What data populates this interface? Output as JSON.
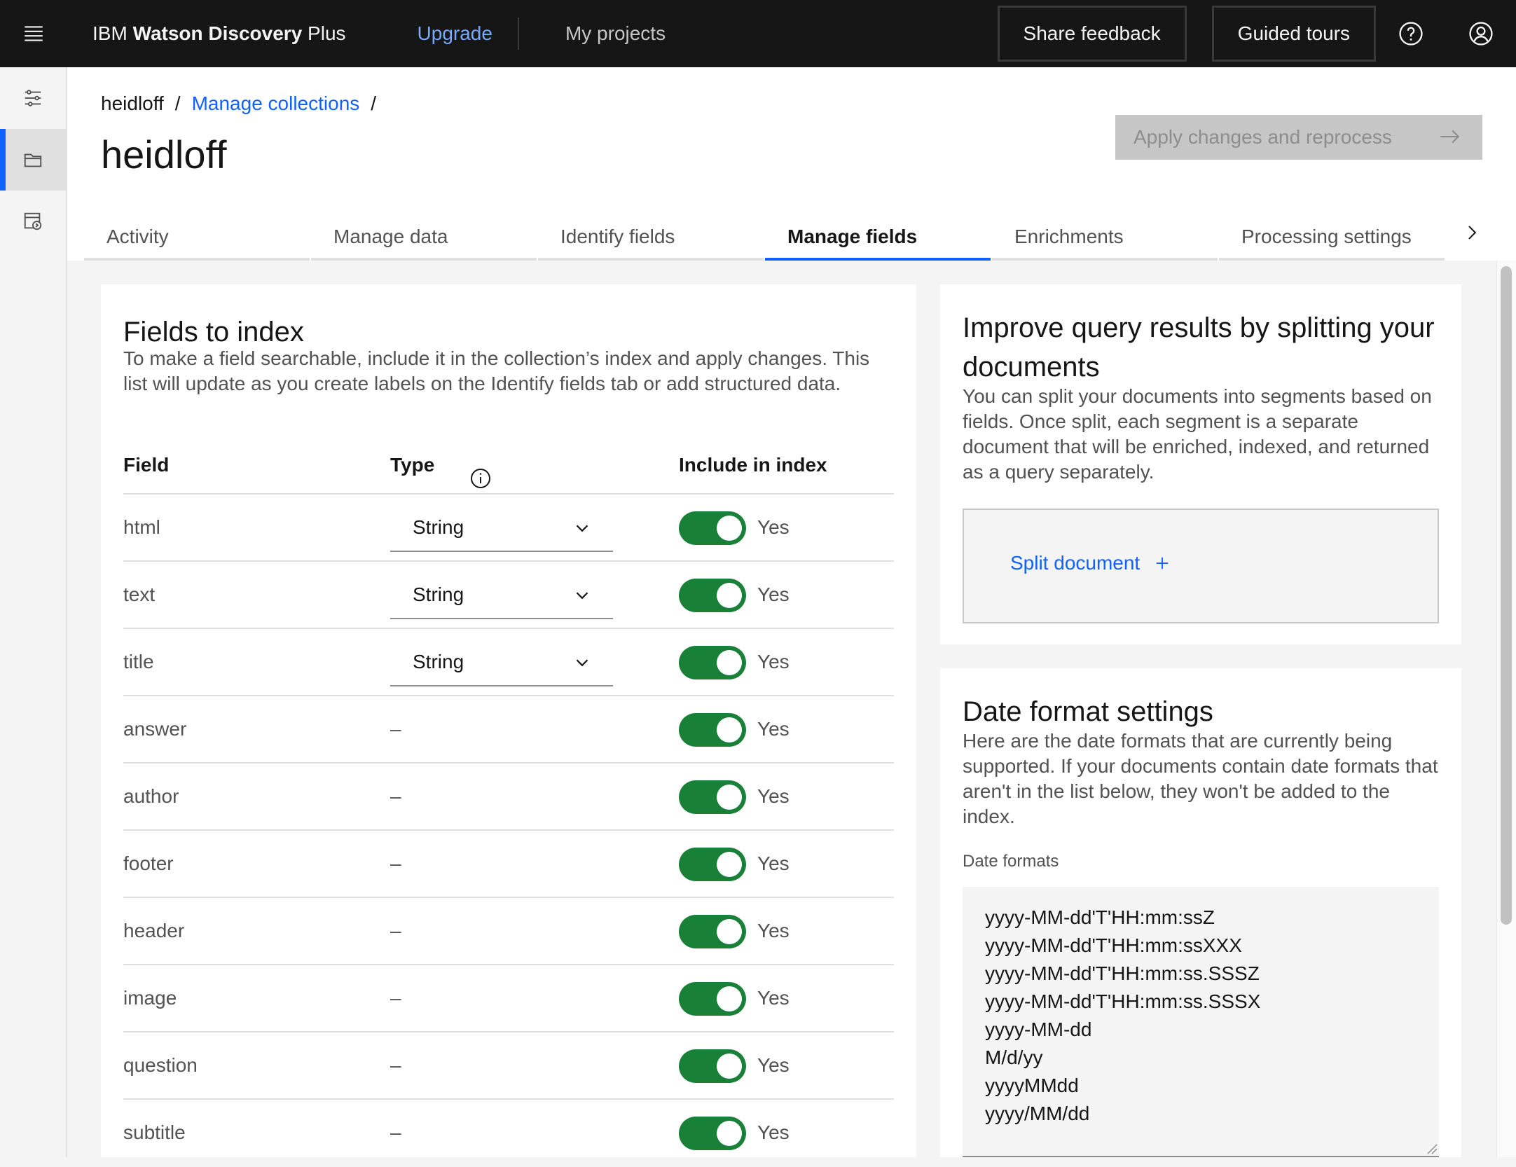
{
  "header": {
    "brand_prefix": "IBM ",
    "brand_bold": "Watson Discovery",
    "brand_suffix": " Plus",
    "upgrade": "Upgrade",
    "my_projects": "My projects",
    "share_feedback": "Share feedback",
    "guided_tours": "Guided tours"
  },
  "breadcrumb": {
    "root": "heidloff",
    "sep": "/",
    "manage_collections": "Manage collections"
  },
  "page_title": "heidloff",
  "apply_button": "Apply changes and reprocess",
  "tabs": [
    "Activity",
    "Manage data",
    "Identify fields",
    "Manage fields",
    "Enrichments",
    "Processing settings"
  ],
  "active_tab": "Manage fields",
  "fields_panel": {
    "title": "Fields to index",
    "description": "To make a field searchable, include it in the collection’s index and apply changes. This list will update as you create labels on the Identify fields tab or add structured data.",
    "col_field": "Field",
    "col_type": "Type",
    "col_include": "Include in index",
    "rows": [
      {
        "field": "html",
        "type": "String",
        "include": "Yes",
        "enabled": true
      },
      {
        "field": "text",
        "type": "String",
        "include": "Yes",
        "enabled": true
      },
      {
        "field": "title",
        "type": "String",
        "include": "Yes",
        "enabled": true
      },
      {
        "field": "answer",
        "type": "–",
        "include": "Yes",
        "enabled": true
      },
      {
        "field": "author",
        "type": "–",
        "include": "Yes",
        "enabled": true
      },
      {
        "field": "footer",
        "type": "–",
        "include": "Yes",
        "enabled": true
      },
      {
        "field": "header",
        "type": "–",
        "include": "Yes",
        "enabled": true
      },
      {
        "field": "image",
        "type": "–",
        "include": "Yes",
        "enabled": true
      },
      {
        "field": "question",
        "type": "–",
        "include": "Yes",
        "enabled": true
      },
      {
        "field": "subtitle",
        "type": "–",
        "include": "Yes",
        "enabled": true
      }
    ]
  },
  "split_panel": {
    "title": "Improve query results by splitting your documents",
    "description": "You can split your documents into segments based on fields. Once split, each segment is a separate document that will be enriched, indexed, and returned as a query separately.",
    "link": "Split document"
  },
  "date_panel": {
    "title": "Date format settings",
    "description": "Here are the date formats that are currently being supported. If your documents contain date formats that aren't in the list below, they won't be added to the index.",
    "label": "Date formats",
    "formats": [
      "yyyy-MM-dd'T'HH:mm:ssZ",
      "yyyy-MM-dd'T'HH:mm:ssXXX",
      "yyyy-MM-dd'T'HH:mm:ss.SSSZ",
      "yyyy-MM-dd'T'HH:mm:ss.SSSX",
      "yyyy-MM-dd",
      "M/d/yy",
      "yyyyMMdd",
      "yyyy/MM/dd"
    ]
  },
  "colors": {
    "header_bg": "#161616",
    "link": "#0f62fe",
    "upgrade_link": "#78a9ff",
    "toggle_on": "#198038",
    "disabled_button": "#c6c6c6"
  }
}
